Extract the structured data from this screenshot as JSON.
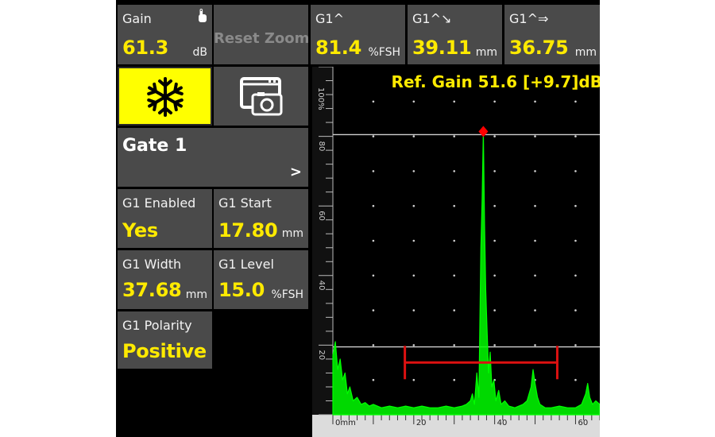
{
  "gain": {
    "label": "Gain",
    "value": "61.3",
    "unit": "dB"
  },
  "reset_zoom": {
    "label": "Reset Zoom"
  },
  "readouts": [
    {
      "label": "G1^",
      "value": "81.4",
      "unit": "%FSH"
    },
    {
      "label": "G1^↘",
      "value": "39.11",
      "unit": "mm"
    },
    {
      "label": "G1^⇒",
      "value": "36.75",
      "unit": "mm"
    }
  ],
  "gate_panel": {
    "title": "Gate 1",
    "chevron": ">"
  },
  "params": {
    "enabled": {
      "label": "G1 Enabled",
      "value": "Yes"
    },
    "start": {
      "label": "G1 Start",
      "value": "17.80",
      "unit": "mm"
    },
    "width": {
      "label": "G1 Width",
      "value": "37.68",
      "unit": "mm"
    },
    "level": {
      "label": "G1 Level",
      "value": "15.0",
      "unit": "%FSH"
    },
    "polarity": {
      "label": "G1 Polarity",
      "value": "Positive"
    }
  },
  "icons": {
    "freeze": "snowflake-icon",
    "screenshot": "camera-icon",
    "touch": "hand-pointer-icon"
  },
  "colors": {
    "accent": "#ffea00",
    "freeze_bg": "#ffff00",
    "signal": "#00ff00",
    "gate": "#dd1111",
    "peak": "#ff0000",
    "tile": "#4a4a4a"
  },
  "chart_data": {
    "type": "line",
    "title": "Ref. Gain 51.6 [+9.7]dB",
    "xlabel": "",
    "ylabel": "",
    "x_unit": "mm",
    "xlim": [
      0,
      66
    ],
    "ylim": [
      0,
      100
    ],
    "x_ticks": [
      "0mm",
      "20",
      "40",
      "60"
    ],
    "y_ticks": [
      "100%",
      "80",
      "60",
      "40",
      "20",
      "0"
    ],
    "grid": true,
    "reference_lines": [
      80.5,
      19.5
    ],
    "gate": {
      "start": 17.8,
      "end": 55.48,
      "level": 15.0
    },
    "peak": {
      "x": 37.2,
      "y": 81.4
    },
    "series": [
      {
        "points": [
          [
            0,
            17
          ],
          [
            0.6,
            21
          ],
          [
            1.2,
            13
          ],
          [
            1.8,
            16
          ],
          [
            2.4,
            10
          ],
          [
            3,
            12
          ],
          [
            3.6,
            6
          ],
          [
            4.2,
            8
          ],
          [
            5,
            4
          ],
          [
            6,
            5
          ],
          [
            7,
            3
          ],
          [
            8,
            3.5
          ],
          [
            9,
            2.5
          ],
          [
            10,
            3
          ],
          [
            12,
            2
          ],
          [
            14,
            2.5
          ],
          [
            16,
            2
          ],
          [
            18,
            2.5
          ],
          [
            20,
            2
          ],
          [
            22,
            2.5
          ],
          [
            24,
            2
          ],
          [
            26,
            2
          ],
          [
            28,
            2.5
          ],
          [
            30,
            2
          ],
          [
            32,
            2.5
          ],
          [
            33,
            3
          ],
          [
            34,
            4
          ],
          [
            34.5,
            6
          ],
          [
            35,
            3
          ],
          [
            35.6,
            12
          ],
          [
            36.1,
            5
          ],
          [
            36.6,
            48
          ],
          [
            36.9,
            62
          ],
          [
            37.2,
            81.4
          ],
          [
            37.5,
            55
          ],
          [
            37.8,
            36
          ],
          [
            38.1,
            25
          ],
          [
            38.5,
            12
          ],
          [
            38.9,
            18
          ],
          [
            39.3,
            8
          ],
          [
            39.8,
            10
          ],
          [
            40.3,
            4
          ],
          [
            41,
            7
          ],
          [
            41.6,
            3
          ],
          [
            42.5,
            4
          ],
          [
            43.5,
            2.5
          ],
          [
            45,
            2
          ],
          [
            47,
            3
          ],
          [
            48,
            4
          ],
          [
            49,
            8
          ],
          [
            49.5,
            13
          ],
          [
            50,
            9
          ],
          [
            50.6,
            5
          ],
          [
            51.2,
            3
          ],
          [
            52.5,
            2
          ],
          [
            54,
            2
          ],
          [
            56,
            2.5
          ],
          [
            58,
            2
          ],
          [
            60,
            2
          ],
          [
            61.5,
            3
          ],
          [
            62.5,
            6
          ],
          [
            63,
            9
          ],
          [
            63.5,
            5
          ],
          [
            64.2,
            3
          ],
          [
            65,
            4
          ],
          [
            66,
            3
          ]
        ]
      }
    ]
  }
}
